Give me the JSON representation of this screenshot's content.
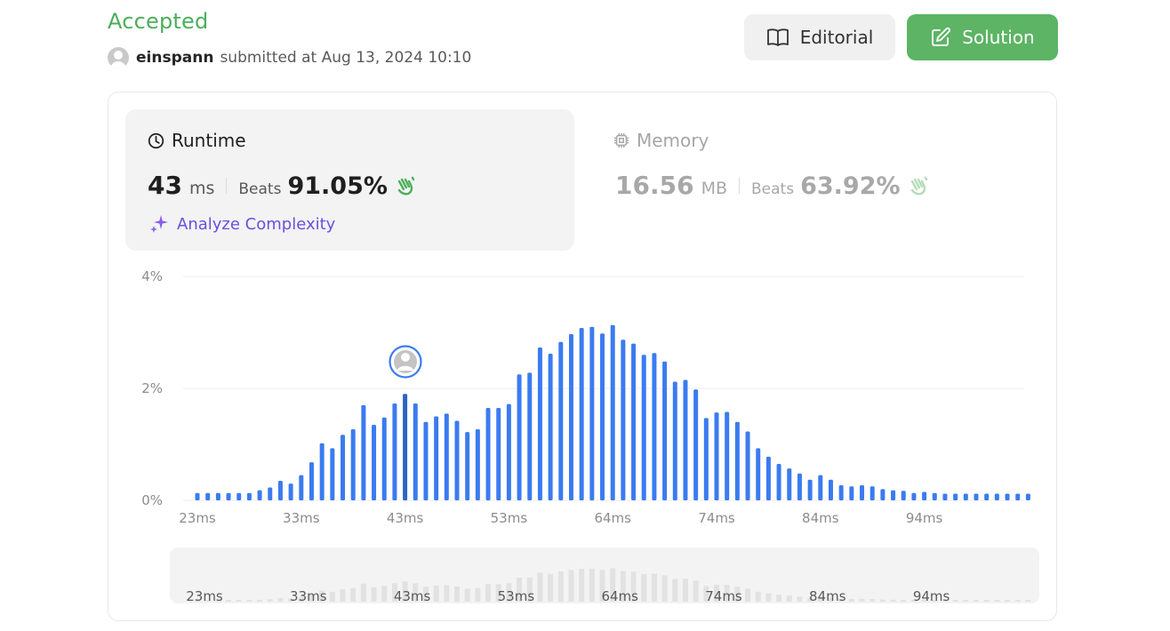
{
  "header": {
    "status": "Accepted",
    "username": "einspann",
    "submitted_text": "submitted at Aug 13, 2024 10:10",
    "editorial_label": "Editorial",
    "solution_label": "Solution"
  },
  "runtime": {
    "title": "Runtime",
    "value": "43",
    "unit": "ms",
    "beats_label": "Beats",
    "beats_value": "91.05%"
  },
  "memory": {
    "title": "Memory",
    "value": "16.56",
    "unit": "MB",
    "beats_label": "Beats",
    "beats_value": "63.92%"
  },
  "analyze_label": "Analyze Complexity",
  "colors": {
    "accent_green": "#4cae5b",
    "bar_blue": "#3b7bf0",
    "bar_highlight": "#2c63c6",
    "analyze_purple": "#6a4fe0"
  },
  "chart_data": {
    "type": "bar",
    "ylim": [
      0,
      4
    ],
    "y_ticks": [
      "0%",
      "2%",
      "4%"
    ],
    "x_tick_labels": [
      "23ms",
      "33ms",
      "43ms",
      "53ms",
      "64ms",
      "74ms",
      "84ms",
      "94ms"
    ],
    "highlight_label": "43ms",
    "values": [
      0.13,
      0.13,
      0.13,
      0.13,
      0.13,
      0.13,
      0.18,
      0.23,
      0.35,
      0.3,
      0.45,
      0.68,
      1.02,
      0.93,
      1.17,
      1.27,
      1.7,
      1.35,
      1.48,
      1.73,
      1.9,
      1.73,
      1.4,
      1.5,
      1.55,
      1.42,
      1.22,
      1.27,
      1.65,
      1.65,
      1.72,
      2.25,
      2.28,
      2.73,
      2.62,
      2.83,
      2.97,
      3.08,
      3.1,
      2.98,
      3.13,
      2.87,
      2.8,
      2.6,
      2.63,
      2.48,
      2.12,
      2.15,
      1.98,
      1.47,
      1.57,
      1.58,
      1.4,
      1.23,
      0.93,
      0.78,
      0.65,
      0.57,
      0.48,
      0.37,
      0.45,
      0.37,
      0.27,
      0.25,
      0.27,
      0.25,
      0.2,
      0.18,
      0.17,
      0.13,
      0.15,
      0.13,
      0.12,
      0.12,
      0.12,
      0.12,
      0.12,
      0.12,
      0.12,
      0.12,
      0.12
    ],
    "highlight_index": 20,
    "xlabel": "",
    "ylabel": "",
    "grid": true
  }
}
